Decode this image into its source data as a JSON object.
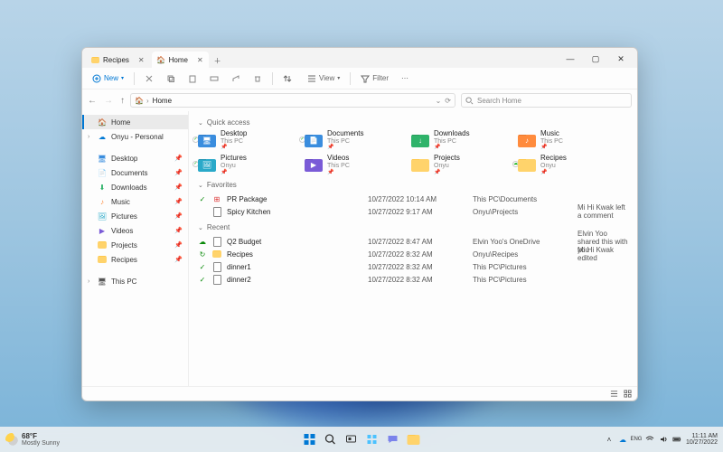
{
  "tabs": [
    {
      "label": "Recipes",
      "active": false,
      "icon": "folder-icon"
    },
    {
      "label": "Home",
      "active": true,
      "icon": "home-icon"
    }
  ],
  "toolbar": {
    "new_label": "New",
    "view_label": "View",
    "filter_label": "Filter"
  },
  "address": {
    "crumb": "Home"
  },
  "search": {
    "placeholder": "Search Home"
  },
  "sidebar": {
    "top": [
      {
        "label": "Home",
        "icon": "home-icon",
        "selected": true
      },
      {
        "label": "Onyu - Personal",
        "icon": "onedrive-icon",
        "selected": false
      }
    ],
    "pinned": [
      {
        "label": "Desktop",
        "icon": "desktop-icon"
      },
      {
        "label": "Documents",
        "icon": "documents-icon"
      },
      {
        "label": "Downloads",
        "icon": "downloads-icon"
      },
      {
        "label": "Music",
        "icon": "music-icon"
      },
      {
        "label": "Pictures",
        "icon": "pictures-icon"
      },
      {
        "label": "Videos",
        "icon": "videos-icon"
      },
      {
        "label": "Projects",
        "icon": "folder-icon"
      },
      {
        "label": "Recipes",
        "icon": "folder-icon"
      }
    ],
    "bottom": [
      {
        "label": "This PC",
        "icon": "thispc-icon"
      }
    ]
  },
  "sections": {
    "quick_access": "Quick access",
    "favorites": "Favorites",
    "recent": "Recent"
  },
  "quick_access": [
    {
      "name": "Desktop",
      "sub": "This PC",
      "color": "blue",
      "glyph": "🖥",
      "badge": "✓"
    },
    {
      "name": "Documents",
      "sub": "This PC",
      "color": "blue",
      "glyph": "📄",
      "badge": "✓"
    },
    {
      "name": "Downloads",
      "sub": "This PC",
      "color": "green",
      "glyph": "↓",
      "badge": ""
    },
    {
      "name": "Music",
      "sub": "This PC",
      "color": "orange",
      "glyph": "♪",
      "badge": ""
    },
    {
      "name": "Pictures",
      "sub": "Onyu",
      "color": "teal",
      "glyph": "🖼",
      "badge": "✓"
    },
    {
      "name": "Videos",
      "sub": "This PC",
      "color": "purple",
      "glyph": "▶",
      "badge": ""
    },
    {
      "name": "Projects",
      "sub": "Onyu",
      "color": "",
      "glyph": "",
      "badge": ""
    },
    {
      "name": "Recipes",
      "sub": "Onyu",
      "color": "",
      "glyph": "",
      "badge": "☁"
    }
  ],
  "favorites": [
    {
      "status": "✓",
      "icon": "package-icon",
      "name": "PR Package",
      "date": "10/27/2022 10:14 AM",
      "location": "This PC\\Documents",
      "activity": ""
    },
    {
      "status": "",
      "icon": "doc-icon",
      "name": "Spicy Kitchen",
      "date": "10/27/2022 9:17 AM",
      "location": "Onyu\\Projects",
      "activity": "Mi Hi Kwak left a comment"
    }
  ],
  "recent": [
    {
      "status": "☁",
      "icon": "xls-icon",
      "name": "Q2 Budget",
      "date": "10/27/2022 8:47 AM",
      "location": "Elvin Yoo's OneDrive",
      "activity": "Elvin Yoo shared this with you"
    },
    {
      "status": "↻",
      "icon": "folder-icon",
      "name": "Recipes",
      "date": "10/27/2022 8:32 AM",
      "location": "Onyu\\Recipes",
      "activity": "Mi Hi Kwak edited"
    },
    {
      "status": "✓",
      "icon": "img-icon",
      "name": "dinner1",
      "date": "10/27/2022 8:32 AM",
      "location": "This PC\\Pictures",
      "activity": ""
    },
    {
      "status": "✓",
      "icon": "img-icon",
      "name": "dinner2",
      "date": "10/27/2022 8:32 AM",
      "location": "This PC\\Pictures",
      "activity": ""
    }
  ],
  "taskbar": {
    "weather_temp": "68°F",
    "weather_desc": "Mostly Sunny",
    "time": "11:11 AM",
    "date": "10/27/2022"
  }
}
